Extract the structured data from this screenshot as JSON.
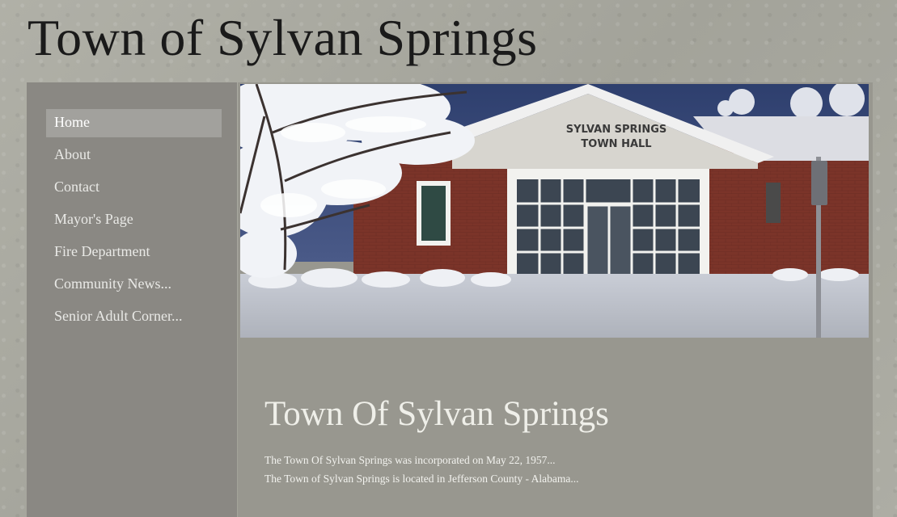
{
  "site": {
    "title": "Town of Sylvan Springs"
  },
  "sidebar": {
    "items": [
      {
        "label": "Home",
        "active": true
      },
      {
        "label": "About"
      },
      {
        "label": "Contact"
      },
      {
        "label": "Mayor's Page"
      },
      {
        "label": "Fire Department"
      },
      {
        "label": "Community News..."
      },
      {
        "label": "Senior Adult Corner..."
      }
    ]
  },
  "hero": {
    "sign_line_1": "SYLVAN SPRINGS",
    "sign_line_2": "TOWN HALL"
  },
  "main": {
    "heading": "Town Of Sylvan Springs",
    "paragraphs": [
      "The Town Of Sylvan Springs was incorporated on May 22, 1957...",
      "The Town of Sylvan Springs is located in Jefferson County - Alabama..."
    ]
  },
  "colors": {
    "background": "#a8a89f",
    "sidebar": "#8a8883",
    "active_item": "#a2a19d",
    "main_panel": "#98978f",
    "brick": "#7a3328"
  }
}
